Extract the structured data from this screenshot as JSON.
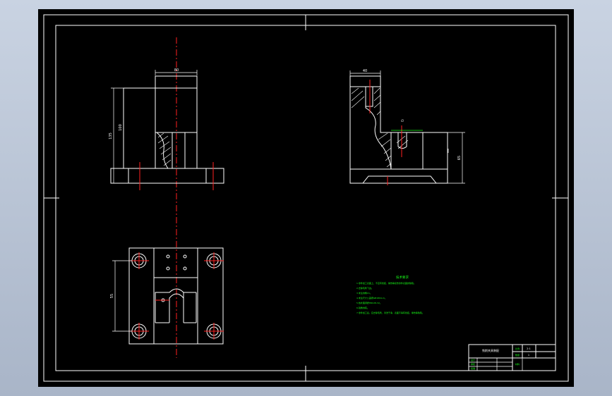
{
  "drawing": {
    "dimensions": {
      "front_top_width": "80",
      "front_height_outer": "135",
      "front_height_inner": "100",
      "side_top_width": "40",
      "side_mid": "∅",
      "side_height": "65",
      "plan_height": "55"
    },
    "technical_requirements": {
      "title": "技术要求",
      "lines": [
        "1.零件加工表面上，不应有划痕、擦伤等损伤零件表面的缺陷。",
        "2.去除毛刺飞边。",
        "3.未注倒角C1。",
        "4.未注尺寸公差按GB1804-m。",
        "5.热处理调质HRC28-32。",
        "6.锐角倒钝。",
        "7.零件加工后，应去除毛刺，清洗干净，表面不得有划痕、擦伤等缺陷。"
      ]
    },
    "title_block": {
      "name": "铣削夹具装配",
      "scale_label": "比例",
      "scale_value": "2:1",
      "qty_label": "数量",
      "qty_value": "1",
      "material_label": "材料",
      "drawn_label": "设计",
      "checked_label": "审核",
      "approved_label": "批准"
    }
  },
  "colors": {
    "background": "#000000",
    "lines": "#ffffff",
    "centerlines": "#ff2020",
    "annotations": "#19ff19"
  }
}
